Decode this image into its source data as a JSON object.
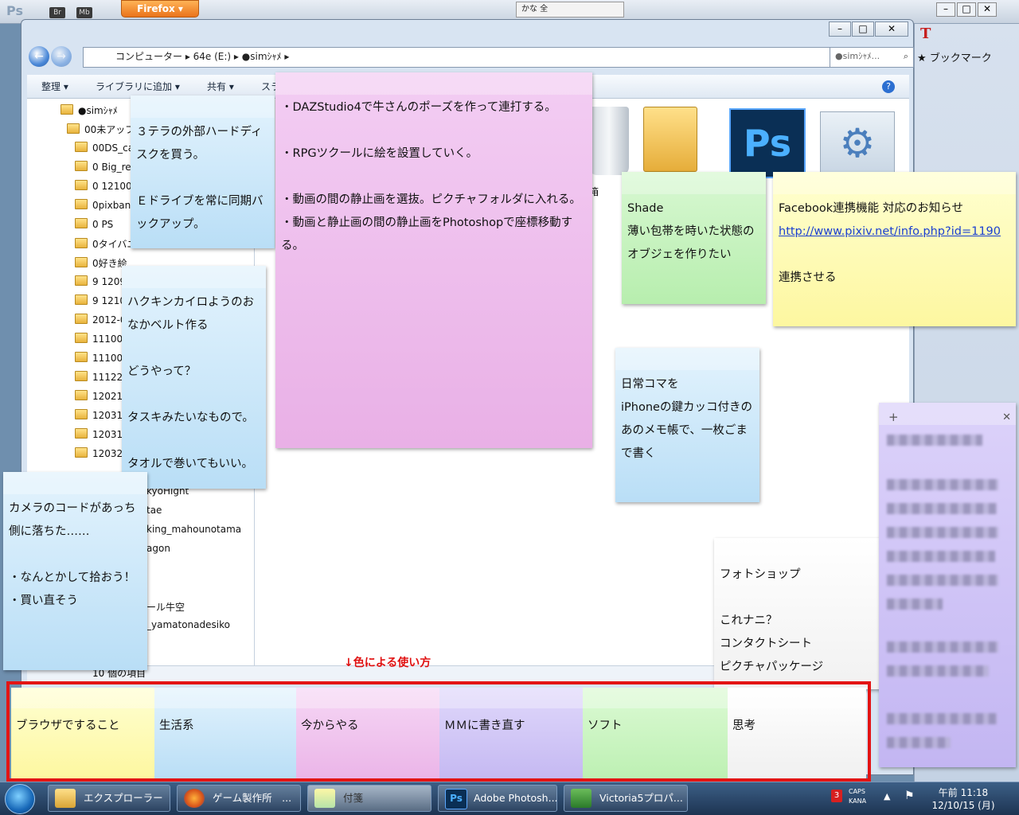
{
  "background_apps": {
    "firefox_button": "Firefox",
    "bookmark_label": "ブックマーク",
    "lang_bar": "かな 全",
    "ps_mini": "Ps",
    "br_mini": "Br",
    "mb_mini": "Mb"
  },
  "explorer": {
    "breadcrumb": "コンピューター ▸ 64e (E:) ▸ ●simｼｬﾒ ▸",
    "search_placeholder": "●simｼｬﾒ...",
    "toolbar": {
      "organize": "整理 ▾",
      "library": "ライブラリに追加 ▾",
      "share": "共有 ▾",
      "slideshow": "スラ"
    },
    "tree_root": "●simｼｬﾒ",
    "tree_items": [
      "00未アップ",
      "00DS_ca",
      "0 Big_re",
      "0 121002",
      "0pixbann",
      "0 PS",
      "0タイバニ",
      "0好き絵",
      "9 1209",
      "9 1210",
      "2012-0",
      "111001",
      "111008",
      "111220",
      "120216",
      "120310",
      "120310",
      "120324"
    ],
    "tree_partial_items": [
      "kyoHight",
      "tae",
      "king_mahounotama",
      "agon",
      "ール牛空",
      "_yamatonadesiko"
    ],
    "status_text": "10 個の項目",
    "recycle_label": "箱"
  },
  "notes": {
    "n1": "３テラの外部ハードディスクを買う。\n\nＥドライブを常に同期バックアップ。",
    "n2": "ハクキンカイロようのおなかベルト作る\n\nどうやって？\n\nタスキみたいなもので。\n\nタオルで巻いてもいい。",
    "n3": "カメラのコードがあっち側に落ちた……\n\n・なんとかして拾おう！\n・買い直そう",
    "n4": "・DAZStudio4で牛さんのポーズを作って連打する。\n\n・RPGツクールに絵を設置していく。\n\n・動画の間の静止画を選抜。ピクチャフォルダに入れる。\n・動画と静止画の間の静止画をPhotoshopで座標移動する。",
    "n5": "Shade\n薄い包帯を時いた状態のオブジェを作りたい",
    "n6_title": "Facebook連携機能 対応のお知らせ",
    "n6_link": "http://www.pixiv.net/info.php?id=1190",
    "n6_tail": "連携させる",
    "n7": "日常コマを\niPhoneの鍵カッコ付きのあのメモ帳で、一枚ごまで書く",
    "n8": "フォトショップ\n\nこれナニ？\nコンタクトシート\nピクチャパッケージ"
  },
  "legend": {
    "label": "↓色による使い方",
    "cells": [
      {
        "label": "ブラウザですること",
        "color": "#fdf7a6"
      },
      {
        "label": "生活系",
        "color": "#c3e4f7"
      },
      {
        "label": "今からやる",
        "color": "#edbdea"
      },
      {
        "label": "ＭＭに書き直す",
        "color": "#cbc2f4"
      },
      {
        "label": "ソフト",
        "color": "#c6f2bd"
      },
      {
        "label": "思考",
        "color": "#f7f7f7"
      }
    ]
  },
  "taskbar": {
    "items": [
      {
        "label": "エクスプローラー"
      },
      {
        "label": "ゲーム製作所　..."
      },
      {
        "label": "付箋"
      },
      {
        "label": "Adobe Photosh..."
      },
      {
        "label": "Victoria5プロパ..."
      }
    ],
    "caps": "CAPS",
    "kana": "KANA",
    "time": "午前 11:18",
    "date": "12/10/15 (月)"
  }
}
